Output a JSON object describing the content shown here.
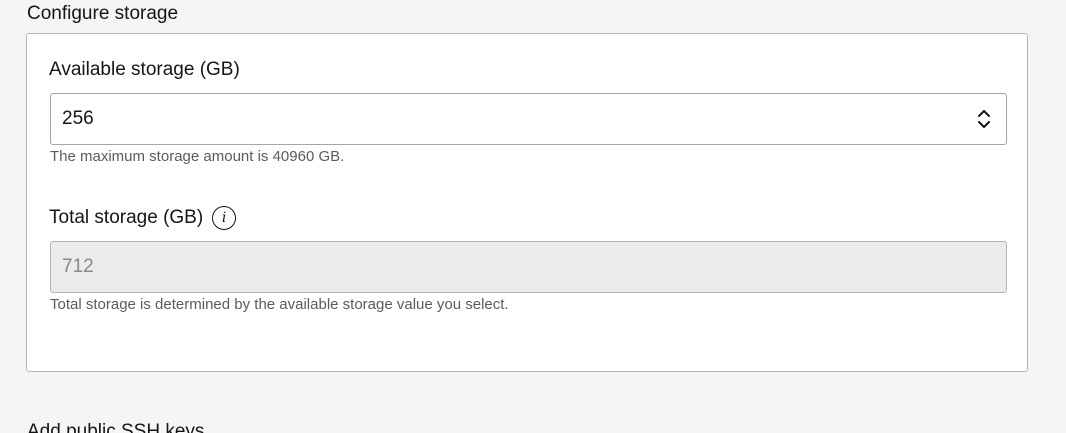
{
  "section": {
    "title": "Configure storage"
  },
  "available_storage": {
    "label": "Available storage (GB)",
    "value": "256",
    "helper": "The maximum storage amount is 40960 GB.",
    "stepper_icon": "chevron-up-down-icon"
  },
  "total_storage": {
    "label": "Total storage (GB)",
    "info_icon_glyph": "i",
    "info_icon": "info-icon",
    "value": "712",
    "helper": "Total storage is determined by the available storage value you select."
  },
  "next_section": {
    "title": "Add public SSH keys"
  }
}
